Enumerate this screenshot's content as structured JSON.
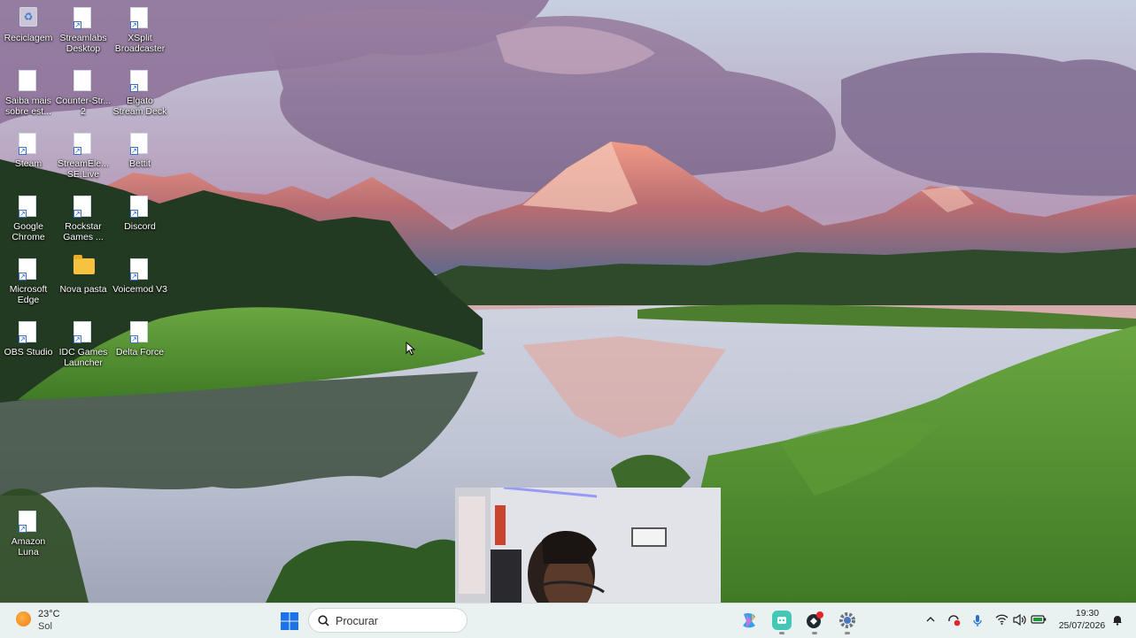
{
  "desktop": {
    "icons": [
      {
        "label": "Reciclagem",
        "type": "bin"
      },
      {
        "label": "Streamlabs Desktop",
        "type": "shortcut"
      },
      {
        "label": "XSplit Broadcaster",
        "type": "shortcut"
      },
      {
        "label": "Saiba mais sobre est...",
        "type": "document"
      },
      {
        "label": "Counter-Str... 2",
        "type": "document"
      },
      {
        "label": "Elgato Stream Deck",
        "type": "shortcut"
      },
      {
        "label": "Steam",
        "type": "shortcut"
      },
      {
        "label": "StreamEle... SE.Live",
        "type": "shortcut"
      },
      {
        "label": "Bettit",
        "type": "shortcut"
      },
      {
        "label": "Google Chrome",
        "type": "shortcut"
      },
      {
        "label": "Rockstar Games ...",
        "type": "shortcut"
      },
      {
        "label": "Discord",
        "type": "shortcut"
      },
      {
        "label": "Microsoft Edge",
        "type": "shortcut"
      },
      {
        "label": "Nova pasta",
        "type": "folder"
      },
      {
        "label": "Voicemod V3",
        "type": "shortcut"
      },
      {
        "label": "OBS Studio",
        "type": "shortcut"
      },
      {
        "label": "IDC Games Launcher",
        "type": "shortcut"
      },
      {
        "label": "Delta Force",
        "type": "shortcut"
      },
      {
        "label": "Amazon Luna",
        "type": "shortcut"
      }
    ]
  },
  "taskbar": {
    "weather": {
      "temperature": "23°C",
      "condition": "Sol",
      "icon": "sun-icon"
    },
    "start_icon": "windows-logo-icon",
    "search_placeholder": "Procurar",
    "pinned_apps": [
      "copilot-icon",
      "app-green-icon",
      "app-badge-icon",
      "settings-gear-icon"
    ],
    "tray": {
      "icons": [
        "chevron-up-icon",
        "security-icon",
        "microphone-icon",
        "wifi-icon",
        "volume-icon",
        "battery-icon",
        "notification-icon"
      ]
    },
    "clock": {
      "time": "19:30",
      "date": "25/07/2026"
    }
  },
  "colors": {
    "taskbar_bg": "#e9f1f1",
    "accent_blue": "#1a73e8",
    "folder_yellow": "#f6c240"
  }
}
